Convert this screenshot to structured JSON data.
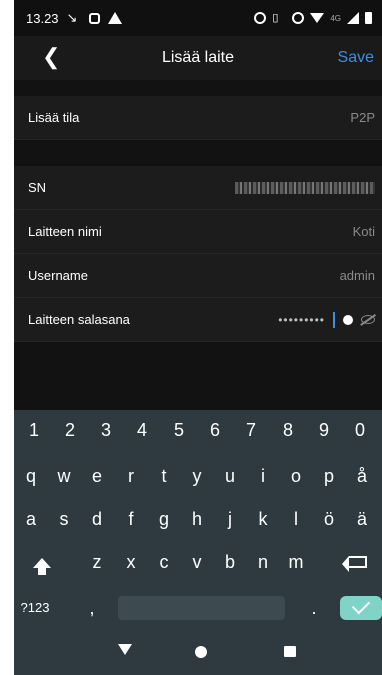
{
  "status_bar": {
    "time": "13.23",
    "network_text": "4G"
  },
  "header": {
    "title": "Lisää laite",
    "save_label": "Save",
    "back_icon": "chevron-left-icon"
  },
  "add_mode": {
    "label": "Lisää tila",
    "value": "P2P"
  },
  "fields": {
    "sn": {
      "label": "SN",
      "value_redacted": "redacted"
    },
    "device_name": {
      "label": "Laitteen nimi",
      "value": "Koti"
    },
    "username": {
      "label": "Username",
      "value": "admin"
    },
    "password": {
      "label": "Laitteen salasana",
      "mask": "•••••••••"
    }
  },
  "keyboard": {
    "number_row": [
      "1",
      "2",
      "3",
      "4",
      "5",
      "6",
      "7",
      "8",
      "9",
      "0"
    ],
    "row1": [
      "q",
      "w",
      "e",
      "r",
      "t",
      "y",
      "u",
      "i",
      "o",
      "p",
      "å"
    ],
    "row2": [
      "a",
      "s",
      "d",
      "f",
      "g",
      "h",
      "j",
      "k",
      "l",
      "ö",
      "ä"
    ],
    "row3": [
      "z",
      "x",
      "c",
      "v",
      "b",
      "n",
      "m"
    ],
    "symbols_label": "?123",
    "comma": ",",
    "period": "."
  },
  "colors": {
    "accent": "#3a8fe0",
    "keyboard_bg": "#2e3a40",
    "enter_key": "#7fd3c7"
  }
}
